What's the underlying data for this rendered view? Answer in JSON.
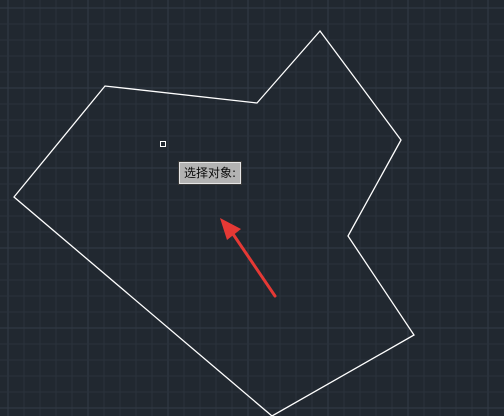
{
  "prompt": {
    "text": "选择对象:"
  },
  "colors": {
    "background": "#212830",
    "grid_minor": "#2a323c",
    "grid_major": "#323b47",
    "polygon_stroke": "#ffffff",
    "arrow": "#e53935",
    "tooltip_bg": "#b3b3b3"
  },
  "icons": {
    "pickbox": "cursor-pickbox-icon",
    "arrow": "red-arrow-annotation"
  }
}
